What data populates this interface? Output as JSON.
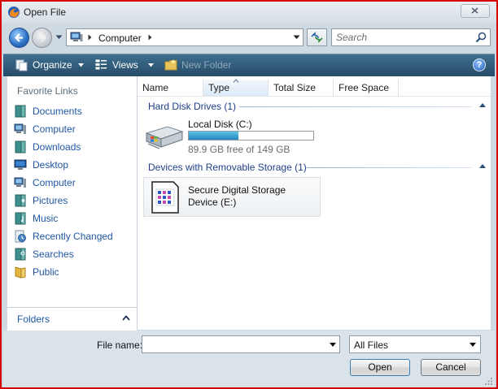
{
  "window": {
    "title": "Open File"
  },
  "address": {
    "location": "Computer",
    "search_placeholder": "Search"
  },
  "toolbar": {
    "organize": "Organize",
    "views": "Views",
    "new_folder": "New Folder",
    "help": "?"
  },
  "sidebar": {
    "title": "Favorite Links",
    "items": [
      {
        "label": "Documents",
        "icon": "documents-icon"
      },
      {
        "label": "Computer",
        "icon": "computer-icon"
      },
      {
        "label": "Downloads",
        "icon": "downloads-icon"
      },
      {
        "label": "Desktop",
        "icon": "desktop-icon"
      },
      {
        "label": "Computer",
        "icon": "computer-icon"
      },
      {
        "label": "Pictures",
        "icon": "pictures-icon"
      },
      {
        "label": "Music",
        "icon": "music-icon"
      },
      {
        "label": "Recently Changed",
        "icon": "recently-changed-icon"
      },
      {
        "label": "Searches",
        "icon": "searches-icon"
      },
      {
        "label": "Public",
        "icon": "public-folder-icon"
      }
    ],
    "folders_label": "Folders"
  },
  "columns": {
    "name": "Name",
    "type": "Type",
    "total_size": "Total Size",
    "free_space": "Free Space"
  },
  "groups": {
    "hard_disks": {
      "title": "Hard Disk Drives (1)",
      "drive_name": "Local Disk (C:)",
      "free_text": "89.9 GB free of 149 GB",
      "used_fraction": 0.4
    },
    "removable": {
      "title": "Devices with Removable Storage (1)",
      "device_name": "Secure Digital Storage Device (E:)"
    }
  },
  "bottom": {
    "file_name_label": "File name:",
    "file_name_value": "",
    "filter": "All Files",
    "open": "Open",
    "cancel": "Cancel"
  },
  "colors": {
    "toolbar": "#2f5a7a",
    "link": "#1f57a4",
    "group_header": "#1e3f8a",
    "frame_border": "#d80000"
  }
}
